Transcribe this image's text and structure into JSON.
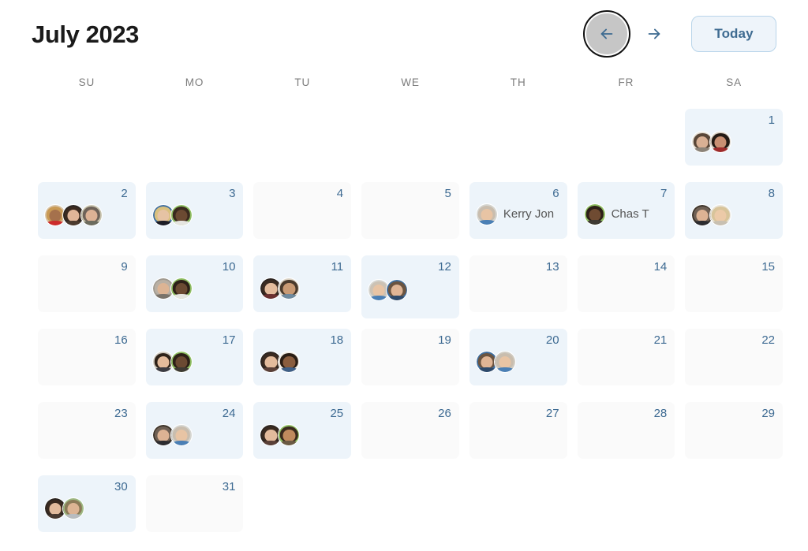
{
  "header": {
    "title": "July 2023",
    "prev_label": "←",
    "prev_name": "previous-month",
    "next_label": "→",
    "next_name": "next-month",
    "today_label": "Today"
  },
  "weekdays": [
    "SU",
    "MO",
    "TU",
    "WE",
    "TH",
    "FR",
    "SA"
  ],
  "colors": {
    "event_cell_bg": "#edf4fa",
    "empty_cell_bg": "#fafafa",
    "day_number": "#3d6a92",
    "today_button_bg": "#eef4fa",
    "today_button_border": "#b9d5ea",
    "today_button_text": "#3e6b91",
    "weekday_text": "#7c7c7c",
    "title_text": "#1a1a1a",
    "prev_button_bg": "#c6c6c6",
    "focus_ring": "#111111"
  },
  "weeks": [
    [
      {
        "blank": true
      },
      {
        "blank": true
      },
      {
        "blank": true
      },
      {
        "blank": true
      },
      {
        "blank": true
      },
      {
        "blank": true
      },
      {
        "day": "1",
        "avatars": [
          {
            "name": "avatar-1a",
            "skin": "#d9b094",
            "hair": "#5a4738",
            "bg": "#e8e2d8",
            "body": "#8c8378"
          },
          {
            "name": "avatar-1b",
            "skin": "#c98f72",
            "hair": "#241a14",
            "bg": "#ddd4c8",
            "body": "#9e2b2b"
          }
        ]
      }
    ],
    [
      {
        "day": "2",
        "avatars": [
          {
            "name": "avatar-2a",
            "skin": "#a5714c",
            "hair": "#c99a55",
            "bg": "#d8c3a5",
            "body": "#cc2b2b"
          },
          {
            "name": "avatar-2b",
            "skin": "#e0b598",
            "hair": "#3b2a1f",
            "bg": "#2a2522",
            "body": "#4b3a2e"
          },
          {
            "name": "avatar-2c",
            "skin": "#ddb295",
            "hair": "#6e6258",
            "bg": "#c9c4ae",
            "body": "#6b6b5e"
          }
        ]
      },
      {
        "day": "3",
        "avatars": [
          {
            "name": "avatar-3a",
            "skin": "#e6c3a4",
            "hair": "#d9c07e",
            "bg": "#3f6fa0",
            "body": "#1d1d26"
          },
          {
            "name": "avatar-3b",
            "skin": "#6b4a32",
            "hair": "#3a2a1e",
            "bg": "#8fbf62",
            "body": "#e5e5e0"
          }
        ]
      },
      {
        "day": "4",
        "avatars": []
      },
      {
        "day": "5",
        "avatars": []
      },
      {
        "day": "6",
        "event": {
          "name": "Kerry Jon",
          "avatar": {
            "name": "avatar-kerry",
            "skin": "#e8c4a4",
            "hair": "#c9bdae",
            "bg": "#d5d5d0",
            "body": "#4a7fb5"
          }
        }
      },
      {
        "day": "7",
        "event": {
          "name": "Chas T",
          "avatar": {
            "name": "avatar-chas",
            "skin": "#6f4b32",
            "hair": "#2d2018",
            "bg": "#8fbf62",
            "body": "#3e3a33"
          }
        }
      },
      {
        "day": "8",
        "avatars": [
          {
            "name": "avatar-8a",
            "skin": "#ddb394",
            "hair": "#6f6054",
            "bg": "#3b3228",
            "body": "#2c2c30"
          },
          {
            "name": "avatar-8b",
            "skin": "#eccaa8",
            "hair": "#d8c49a",
            "bg": "#e9e4d8",
            "body": "#c8c0b2"
          }
        ]
      }
    ],
    [
      {
        "day": "9",
        "avatars": []
      },
      {
        "day": "10",
        "avatars": [
          {
            "name": "avatar-10a",
            "skin": "#dcb494",
            "hair": "#b9b0a4",
            "bg": "#a09a90",
            "body": "#7a736a"
          },
          {
            "name": "avatar-10b",
            "skin": "#6b4a32",
            "hair": "#2d2018",
            "bg": "#8fbf62",
            "body": "#e5e5e0"
          }
        ]
      },
      {
        "day": "11",
        "avatars": [
          {
            "name": "avatar-11a",
            "skin": "#e3bb9c",
            "hair": "#3a2a20",
            "bg": "#2b2420",
            "body": "#6b3030"
          },
          {
            "name": "avatar-11b",
            "skin": "#c99a74",
            "hair": "#4a3a2c",
            "bg": "#ded6c8",
            "body": "#6f8a9e"
          }
        ]
      },
      {
        "day": "12",
        "hovered": true,
        "avatars": [
          {
            "name": "avatar-12a",
            "skin": "#e8c4a4",
            "hair": "#ccc2b4",
            "bg": "#d5d5d0",
            "body": "#4a7fb5"
          },
          {
            "name": "avatar-12b",
            "skin": "#e0b595",
            "hair": "#6b5440",
            "bg": "#3f6fa0",
            "body": "#2e4a6b"
          }
        ]
      },
      {
        "day": "13",
        "avatars": []
      },
      {
        "day": "14",
        "avatars": []
      },
      {
        "day": "15",
        "avatars": []
      }
    ],
    [
      {
        "day": "16",
        "avatars": []
      },
      {
        "day": "17",
        "avatars": [
          {
            "name": "avatar-17a",
            "skin": "#e3bb9c",
            "hair": "#2e2219",
            "bg": "#cfcac0",
            "body": "#3b3b42"
          },
          {
            "name": "avatar-17b",
            "skin": "#6b4a32",
            "hair": "#2d2018",
            "bg": "#8fbf62",
            "body": "#3e3a33"
          }
        ]
      },
      {
        "day": "18",
        "avatars": [
          {
            "name": "avatar-18a",
            "skin": "#e3bb9c",
            "hair": "#3a2a20",
            "bg": "#2b2420",
            "body": "#5a4038"
          },
          {
            "name": "avatar-18b",
            "skin": "#8a5d3e",
            "hair": "#2a1d14",
            "bg": "#f0ece4",
            "body": "#3f5f86"
          }
        ]
      },
      {
        "day": "19",
        "avatars": []
      },
      {
        "day": "20",
        "avatars": [
          {
            "name": "avatar-20a",
            "skin": "#e0b595",
            "hair": "#6b5440",
            "bg": "#3f6fa0",
            "body": "#2e4a6b"
          },
          {
            "name": "avatar-20b",
            "skin": "#e8c4a4",
            "hair": "#c9bdae",
            "bg": "#cfcac0",
            "body": "#4a7fb5"
          }
        ]
      },
      {
        "day": "21",
        "avatars": []
      },
      {
        "day": "22",
        "avatars": []
      }
    ],
    [
      {
        "day": "23",
        "avatars": []
      },
      {
        "day": "24",
        "avatars": [
          {
            "name": "avatar-24a",
            "skin": "#ddb394",
            "hair": "#6f6054",
            "bg": "#3b3228",
            "body": "#2c2c30"
          },
          {
            "name": "avatar-24b",
            "skin": "#e8c4a4",
            "hair": "#c9bdae",
            "bg": "#d5d5d0",
            "body": "#4a7fb5"
          }
        ]
      },
      {
        "day": "25",
        "avatars": [
          {
            "name": "avatar-25a",
            "skin": "#e3bb9c",
            "hair": "#3a2a20",
            "bg": "#2b2420",
            "body": "#5a4038"
          },
          {
            "name": "avatar-25b",
            "skin": "#c08a5e",
            "hair": "#3a2a1e",
            "bg": "#8fbf62",
            "body": "#6b5a44"
          }
        ]
      },
      {
        "day": "26",
        "avatars": []
      },
      {
        "day": "27",
        "avatars": []
      },
      {
        "day": "28",
        "avatars": []
      },
      {
        "day": "29",
        "avatars": []
      }
    ],
    [
      {
        "day": "30",
        "avatars": [
          {
            "name": "avatar-30a",
            "skin": "#e3bb9c",
            "hair": "#3a2a20",
            "bg": "#2b2420",
            "body": "#4a3a30"
          },
          {
            "name": "avatar-30b",
            "skin": "#dcb494",
            "hair": "#8a7a58",
            "bg": "#9fba84",
            "body": "#b8bcc0"
          }
        ]
      },
      {
        "day": "31",
        "avatars": []
      },
      {
        "blank": true
      },
      {
        "blank": true
      },
      {
        "blank": true
      },
      {
        "blank": true
      },
      {
        "blank": true
      }
    ]
  ]
}
